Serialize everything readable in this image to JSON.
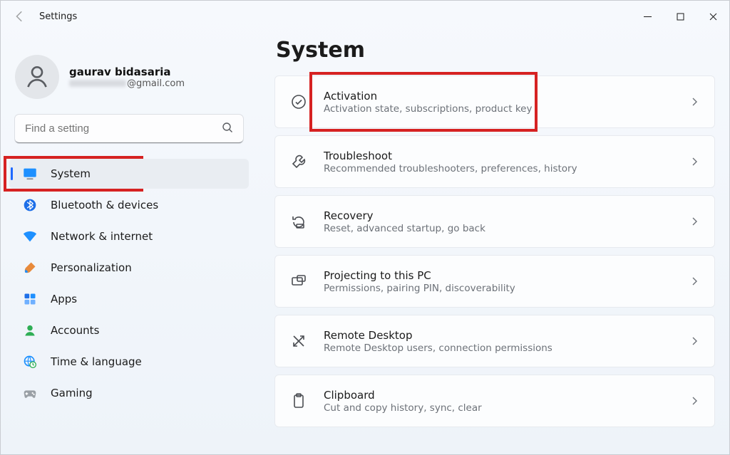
{
  "titlebar": {
    "title": "Settings"
  },
  "user": {
    "name": "gaurav bidasaria",
    "email_suffix": "@gmail.com"
  },
  "search": {
    "placeholder": "Find a setting"
  },
  "sidebar": {
    "items": [
      {
        "label": "System",
        "icon": "system-icon",
        "selected": true
      },
      {
        "label": "Bluetooth & devices",
        "icon": "bluetooth-icon"
      },
      {
        "label": "Network & internet",
        "icon": "wifi-icon"
      },
      {
        "label": "Personalization",
        "icon": "brush-icon"
      },
      {
        "label": "Apps",
        "icon": "apps-icon"
      },
      {
        "label": "Accounts",
        "icon": "person-icon"
      },
      {
        "label": "Time & language",
        "icon": "globe-clock-icon"
      },
      {
        "label": "Gaming",
        "icon": "gamepad-icon"
      }
    ]
  },
  "page": {
    "title": "System"
  },
  "cards": [
    {
      "title": "Activation",
      "sub": "Activation state, subscriptions, product key",
      "icon": "check-circle-icon",
      "highlight": true
    },
    {
      "title": "Troubleshoot",
      "sub": "Recommended troubleshooters, preferences, history",
      "icon": "wrench-icon"
    },
    {
      "title": "Recovery",
      "sub": "Reset, advanced startup, go back",
      "icon": "recovery-icon"
    },
    {
      "title": "Projecting to this PC",
      "sub": "Permissions, pairing PIN, discoverability",
      "icon": "project-icon"
    },
    {
      "title": "Remote Desktop",
      "sub": "Remote Desktop users, connection permissions",
      "icon": "remote-arrow-icon"
    },
    {
      "title": "Clipboard",
      "sub": "Cut and copy history, sync, clear",
      "icon": "clipboard-icon"
    }
  ]
}
